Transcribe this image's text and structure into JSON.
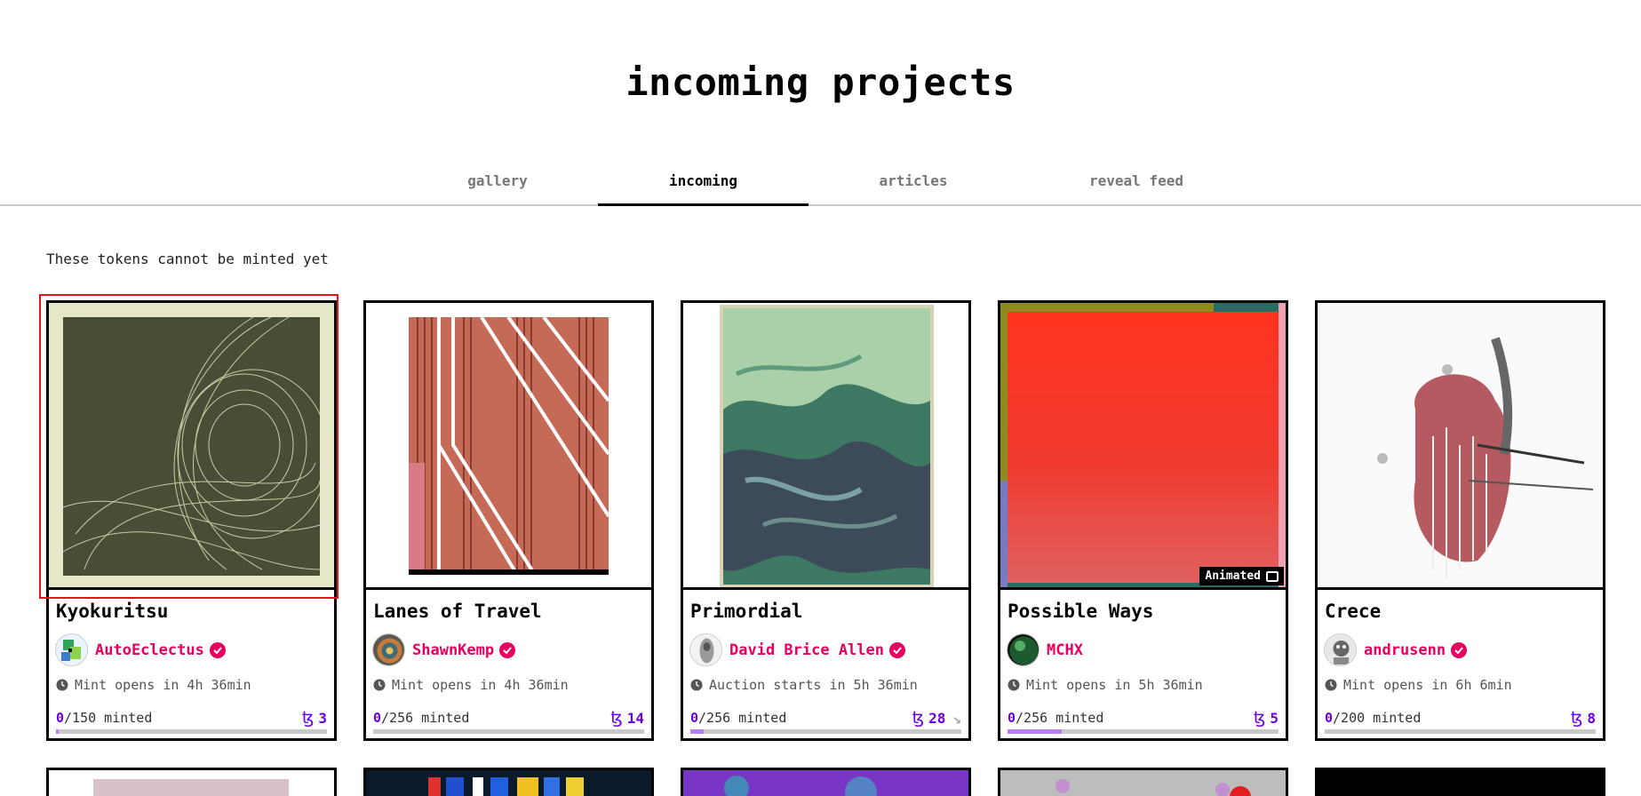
{
  "page": {
    "title": "incoming projects"
  },
  "tabs": [
    {
      "label": "gallery"
    },
    {
      "label": "incoming"
    },
    {
      "label": "articles"
    },
    {
      "label": "reveal feed"
    }
  ],
  "notice": "These tokens cannot be minted yet",
  "currency_symbol": "ꜩ",
  "cards": [
    {
      "title": "Kyokuritsu",
      "artist": "AutoEclectus",
      "status": "Mint opens in 4h 36min",
      "minted": "0",
      "total": "/150 minted",
      "price": "3",
      "progress": 0.01
    },
    {
      "title": "Lanes of Travel",
      "artist": "ShawnKemp",
      "status": "Mint opens in 4h 36min",
      "minted": "0",
      "total": "/256 minted",
      "price": "14",
      "progress": 0.0
    },
    {
      "title": "Primordial",
      "artist": "David Brice Allen",
      "status": "Auction starts in 5h 36min",
      "minted": "0",
      "total": "/256 minted",
      "price": "28",
      "progress": 0.05
    },
    {
      "title": "Possible Ways",
      "artist": "MCHX",
      "status": "Mint opens in 5h 36min",
      "minted": "0",
      "total": "/256 minted",
      "price": "5",
      "progress": 0.2,
      "badge": "Animated"
    },
    {
      "title": "Crece",
      "artist": "andrusenn",
      "status": "Mint opens in 6h 6min",
      "minted": "0",
      "total": "/200 minted",
      "price": "8",
      "progress": 0.0
    }
  ],
  "colors": {
    "artist": "#e8005f",
    "accent": "#6a00e0",
    "progress": "#b97cf4",
    "highlight": "#e5141a"
  }
}
